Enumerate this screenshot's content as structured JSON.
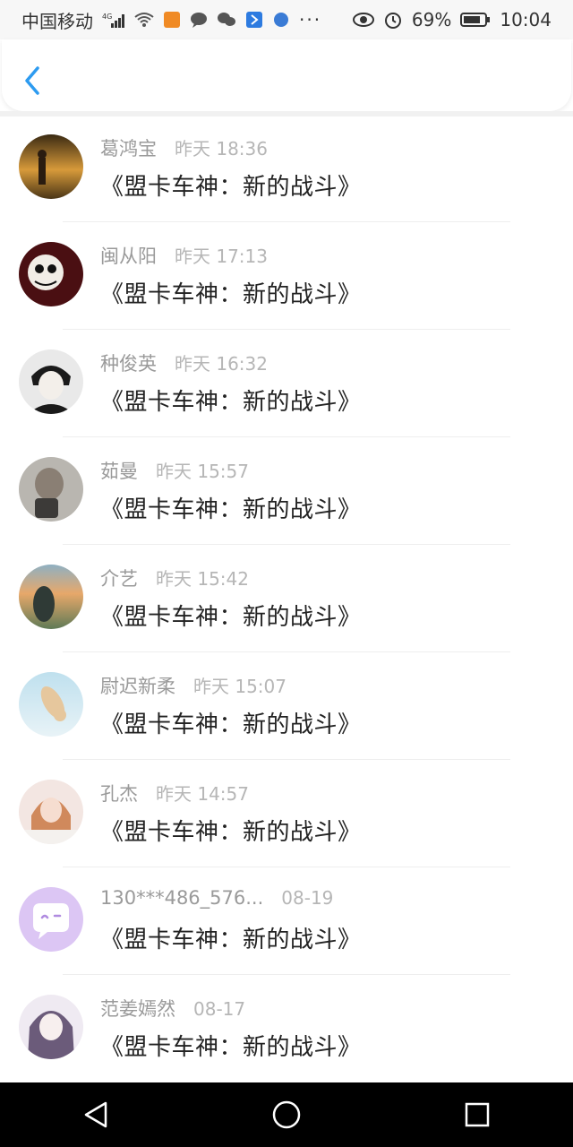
{
  "status": {
    "carrier": "中国移动",
    "network": "4G",
    "battery": "69%",
    "time": "10:04",
    "overflow": "···"
  },
  "header": {
    "back_icon": "chevron-left-icon",
    "accent": "#2d9bf0"
  },
  "message_items": [
    {
      "name": "葛鸿宝",
      "time": "昨天 18:36",
      "text": "《盟卡车神：新的战斗》"
    },
    {
      "name": "闽从阳",
      "time": "昨天 17:13",
      "text": "《盟卡车神：新的战斗》"
    },
    {
      "name": "种俊英",
      "time": "昨天 16:32",
      "text": "《盟卡车神：新的战斗》"
    },
    {
      "name": "茹曼",
      "time": "昨天 15:57",
      "text": "《盟卡车神：新的战斗》"
    },
    {
      "name": "介艺",
      "time": "昨天 15:42",
      "text": "《盟卡车神：新的战斗》"
    },
    {
      "name": "尉迟新柔",
      "time": "昨天 15:07",
      "text": "《盟卡车神：新的战斗》"
    },
    {
      "name": "孔杰",
      "time": "昨天 14:57",
      "text": "《盟卡车神：新的战斗》"
    },
    {
      "name": "130***486_576...",
      "time": "08-19",
      "text": "《盟卡车神：新的战斗》"
    },
    {
      "name": "范姜嫣然",
      "time": "08-17",
      "text": "《盟卡车神：新的战斗》"
    }
  ],
  "navbar": {
    "back": "triangle-back-icon",
    "home": "circle-home-icon",
    "recent": "square-recent-icon"
  }
}
